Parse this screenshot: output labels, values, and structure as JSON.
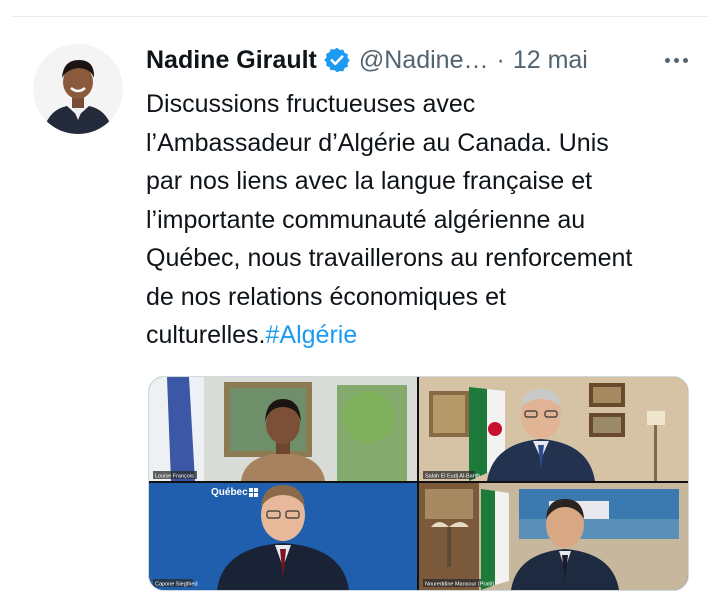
{
  "tweet": {
    "author_name": "Nadine Girault",
    "handle": "@Nadine…",
    "separator": "·",
    "date": "12 mai",
    "verified_icon": "verified-badge-icon",
    "more_icon": "more-options-icon",
    "text_lines": [
      "Discussions fructueuses avec",
      "l’Ambassadeur d’Algérie au Canada. Unis",
      "par nos liens avec la langue française et",
      "l’importante communauté algérienne au",
      "Québec, nous travaillerons au renforcement",
      "de nos relations économiques et",
      "culturelles."
    ],
    "hashtag": "#Algérie"
  },
  "media": {
    "tiles": [
      {
        "caption": "Louise François"
      },
      {
        "caption": "Salah El Eudj Al-Bahth"
      },
      {
        "caption": "Capone Siegfried",
        "logo_text": "Québec"
      },
      {
        "caption": "Noureddine Mansour (Pratit)"
      }
    ]
  },
  "colors": {
    "hashtag": "#1d9bf0",
    "verified": "#1d9bf0",
    "secondary_text": "#536471"
  }
}
